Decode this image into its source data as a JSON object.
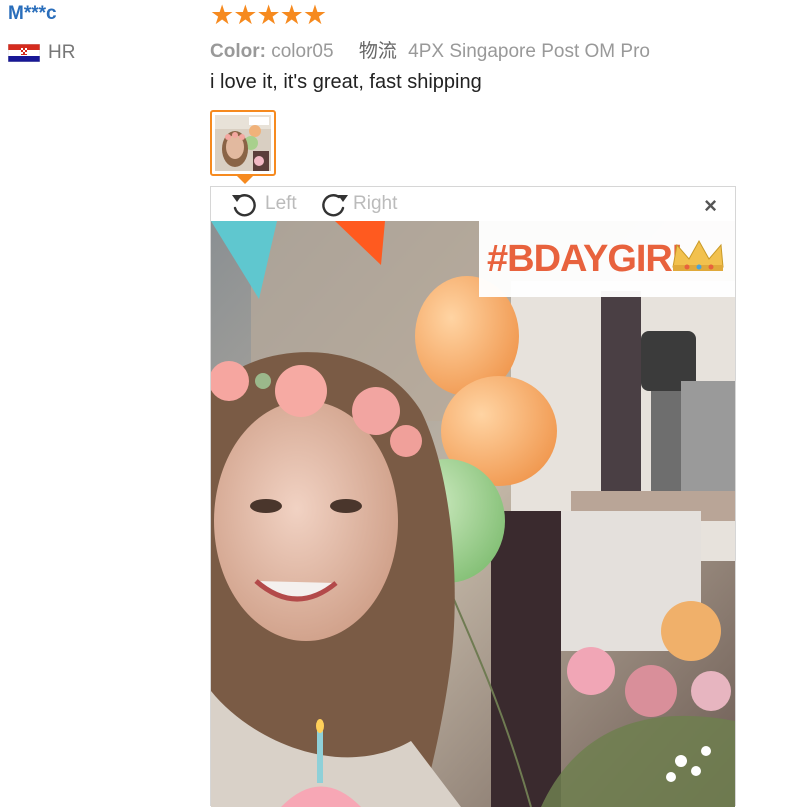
{
  "review": {
    "user": "M***c",
    "country_code": "HR",
    "rating": 5,
    "star_glyph": "★",
    "attr_label": "Color:",
    "attr_value": "color05",
    "logistics_label": "物流",
    "logistics_value": "4PX Singapore Post OM Pro",
    "text": "i love it, it's great, fast shipping"
  },
  "viewer": {
    "rotate_left_label": "Left",
    "rotate_right_label": "Right",
    "close_glyph": "×",
    "sticker_text": "#BDAYGIRL"
  },
  "colors": {
    "accent": "#f68a1f",
    "username": "#2a6ebb",
    "sticker": "#e8623d"
  }
}
